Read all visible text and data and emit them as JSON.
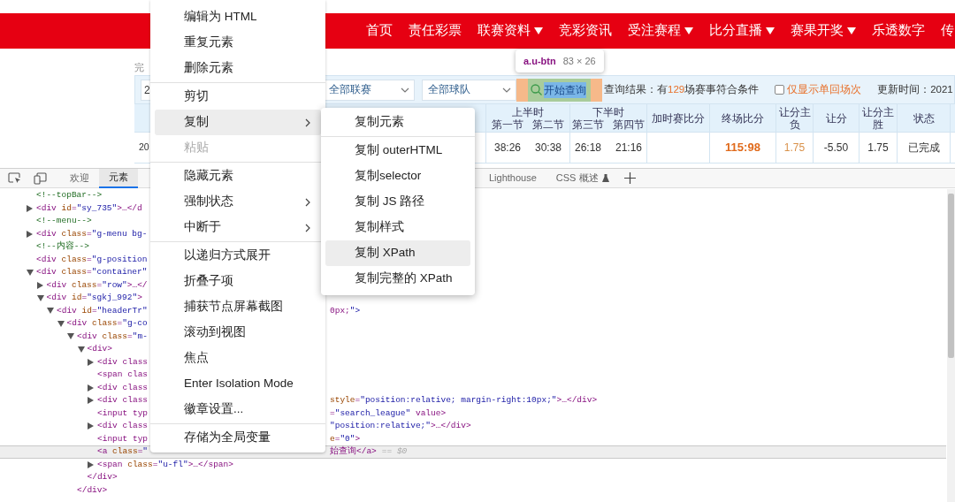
{
  "nav": {
    "items": [
      {
        "label": "首页",
        "dropdown": false
      },
      {
        "label": "责任彩票",
        "dropdown": false
      },
      {
        "label": "联赛资料",
        "dropdown": true
      },
      {
        "label": "竞彩资讯",
        "dropdown": false
      },
      {
        "label": "受注赛程",
        "dropdown": true
      },
      {
        "label": "比分直播",
        "dropdown": true
      },
      {
        "label": "赛果开奖",
        "dropdown": true
      },
      {
        "label": "乐透数字",
        "dropdown": false
      },
      {
        "label": "传"
      }
    ]
  },
  "breadcrumb": "完",
  "filter": {
    "date_value": "2",
    "league_select": "全部联赛",
    "team_select": "全部球队",
    "search_button": "开始查询",
    "result_prefix": "查询结果：有",
    "result_count": "129",
    "result_suffix": "场赛事符合条件",
    "single_only": {
      "label": "仅显示单回场次",
      "checked": false
    },
    "update_time": "更新时间：2021"
  },
  "tooltip": {
    "selector": "a.u-btn",
    "size": "83 × 26"
  },
  "table": {
    "columns": [
      {
        "label": "上半时",
        "parts": [
          "第一节",
          "第二节"
        ]
      },
      {
        "label": "下半时",
        "parts": [
          "第三节",
          "第四节"
        ]
      },
      {
        "label": "加时赛比分"
      },
      {
        "label": "终场比分"
      },
      {
        "label": "让分主负"
      },
      {
        "label": "让分"
      },
      {
        "label": "让分主胜"
      },
      {
        "label": "状态"
      }
    ],
    "rows": [
      {
        "date": "20",
        "quarters": [
          "38:26",
          "30:38",
          "26:18",
          "21:16"
        ],
        "final": "115:98",
        "handicap_lose": "1.75",
        "handicap": "-5.50",
        "handicap_win": "1.75",
        "status": "已完成"
      }
    ]
  },
  "devtools": {
    "tabs": [
      {
        "label": "欢迎",
        "selected": false
      },
      {
        "label": "元素",
        "selected": true
      },
      {
        "label": "Lighthouse",
        "selected": false
      },
      {
        "label": "CSS 概述",
        "selected": false
      }
    ],
    "tree": [
      {
        "text": "<!--topBar-->",
        "kind": "plain",
        "selected": false
      },
      {
        "text": "<div id=\"sy_735\">…</d",
        "kind": "collapsed",
        "selected": false
      },
      {
        "text": "<!--menu-->",
        "kind": "plain",
        "selected": false
      },
      {
        "text": "<div class=\"g-menu bg-",
        "kind": "collapsed",
        "selected": false
      },
      {
        "text": "<!--内容-->",
        "kind": "plain",
        "selected": false
      },
      {
        "text": "<div class=\"g-position",
        "kind": "plain",
        "selected": false
      },
      {
        "text": "<div class=\"container\"",
        "kind": "expanded",
        "selected": false,
        "children": [
          {
            "text": "<div class=\"row\">…</",
            "kind": "collapsed",
            "selected": false
          },
          {
            "text": "<div id=\"sgkj_992\">",
            "kind": "expanded",
            "selected": false,
            "children": [
              {
                "text": "<div id=\"headerTr\"",
                "right": "0px;\">",
                "kind": "expanded",
                "selected": false,
                "children": [
                  {
                    "text": "<div class=\"g-co",
                    "kind": "expanded",
                    "selected": false,
                    "children": [
                      {
                        "text": "<div class=\"m-",
                        "kind": "expanded",
                        "selected": false,
                        "children": [
                          {
                            "text": "<div>",
                            "kind": "expanded",
                            "selected": false,
                            "children": [
                              {
                                "text": "<div class",
                                "kind": "collapsed",
                                "selected": false
                              },
                              {
                                "text": "<span clas",
                                "kind": "plain",
                                "selected": false
                              },
                              {
                                "text": "<div class",
                                "kind": "collapsed",
                                "selected": false
                              },
                              {
                                "text": "<div class",
                                "right": "style=\"position:relative; margin-right:10px;\">…</div>",
                                "kind": "collapsed",
                                "selected": false
                              },
                              {
                                "text": "<input typ",
                                "right": "=\"search_league\" value>",
                                "kind": "plain",
                                "selected": false
                              },
                              {
                                "text": "<div class",
                                "right": "\"position:relative;\">…</div>",
                                "kind": "collapsed",
                                "selected": false
                              },
                              {
                                "text": "<input typ",
                                "right": "e=\"0\">",
                                "kind": "plain",
                                "selected": false
                              },
                              {
                                "text": "<a class=\"",
                                "right": "始查询</a>",
                                "marker": "== $0",
                                "kind": "plain",
                                "selected": true
                              },
                              {
                                "text": "<span class=\"u-fl\">…</span>",
                                "kind": "collapsed",
                                "selected": false
                              }
                            ]
                          },
                          {
                            "text": "</div>",
                            "kind": "plain",
                            "selected": false
                          }
                        ]
                      },
                      {
                        "text": "</div>",
                        "kind": "plain",
                        "selected": false
                      }
                    ]
                  }
                ]
              }
            ]
          }
        ]
      }
    ]
  },
  "context_menu": {
    "groups": [
      [
        {
          "label": "编辑为 HTML",
          "highlighted": false,
          "disabled": false,
          "submenu": false
        },
        {
          "label": "重复元素",
          "highlighted": false,
          "disabled": false,
          "submenu": false
        },
        {
          "label": "删除元素",
          "highlighted": false,
          "disabled": false,
          "submenu": false
        }
      ],
      [
        {
          "label": "剪切",
          "highlighted": false,
          "disabled": false,
          "submenu": false
        },
        {
          "label": "复制",
          "highlighted": true,
          "disabled": false,
          "submenu": true
        },
        {
          "label": "粘贴",
          "highlighted": false,
          "disabled": true,
          "submenu": false
        }
      ],
      [
        {
          "label": "隐藏元素",
          "highlighted": false,
          "disabled": false,
          "submenu": false
        },
        {
          "label": "强制状态",
          "highlighted": false,
          "disabled": false,
          "submenu": true
        },
        {
          "label": "中断于",
          "highlighted": false,
          "disabled": false,
          "submenu": true
        }
      ],
      [
        {
          "label": "以递归方式展开",
          "highlighted": false,
          "disabled": false,
          "submenu": false
        },
        {
          "label": "折叠子项",
          "highlighted": false,
          "disabled": false,
          "submenu": false
        },
        {
          "label": "捕获节点屏幕截图",
          "highlighted": false,
          "disabled": false,
          "submenu": false
        },
        {
          "label": "滚动到视图",
          "highlighted": false,
          "disabled": false,
          "submenu": false
        },
        {
          "label": "焦点",
          "highlighted": false,
          "disabled": false,
          "submenu": false
        },
        {
          "label": "Enter Isolation Mode",
          "highlighted": false,
          "disabled": false,
          "submenu": false
        },
        {
          "label": "徽章设置...",
          "highlighted": false,
          "disabled": false,
          "submenu": false
        }
      ],
      [
        {
          "label": "存储为全局变量",
          "highlighted": false,
          "disabled": false,
          "submenu": false
        }
      ]
    ]
  },
  "submenu": {
    "groups": [
      [
        {
          "label": "复制元素",
          "highlighted": false
        }
      ],
      [
        {
          "label": "复制 outerHTML",
          "highlighted": false
        },
        {
          "label": "复制selector",
          "highlighted": false
        },
        {
          "label": "复制 JS 路径",
          "highlighted": false
        },
        {
          "label": "复制样式",
          "highlighted": false
        },
        {
          "label": "复制 XPath",
          "highlighted": true
        },
        {
          "label": "复制完整的 XPath",
          "highlighted": false
        }
      ]
    ]
  }
}
